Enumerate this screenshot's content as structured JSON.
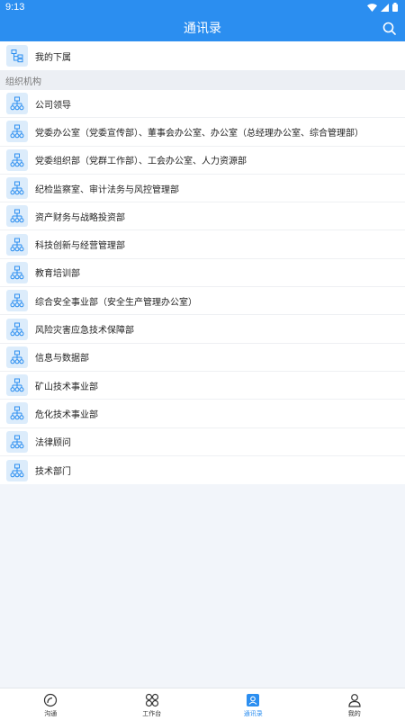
{
  "status_bar": {
    "time": "9:13"
  },
  "header": {
    "title": "通讯录"
  },
  "subordinates": {
    "label": "我的下属"
  },
  "org_section": {
    "title": "组织机构"
  },
  "departments": [
    "公司领导",
    "党委办公室（党委宣传部）、董事会办公室、办公室（总经理办公室、综合管理部）",
    "党委组织部（党群工作部）、工会办公室、人力资源部",
    "纪检监察室、审计法务与风控管理部",
    "资产财务与战略投资部",
    "科技创新与经营管理部",
    "教育培训部",
    "综合安全事业部（安全生产管理办公室）",
    "风险灾害应急技术保障部",
    "信息与数据部",
    "矿山技术事业部",
    "危化技术事业部",
    "法律顾问",
    "技术部门"
  ],
  "tabs": [
    {
      "label": "沟通",
      "icon": "chat-icon",
      "active": false
    },
    {
      "label": "工作台",
      "icon": "workbench-icon",
      "active": false
    },
    {
      "label": "通讯录",
      "icon": "contacts-icon",
      "active": true
    },
    {
      "label": "我的",
      "icon": "profile-icon",
      "active": false
    }
  ],
  "colors": {
    "primary": "#2b8ef0",
    "icon_bg": "#dcecfb",
    "background": "#f2f5fa"
  }
}
